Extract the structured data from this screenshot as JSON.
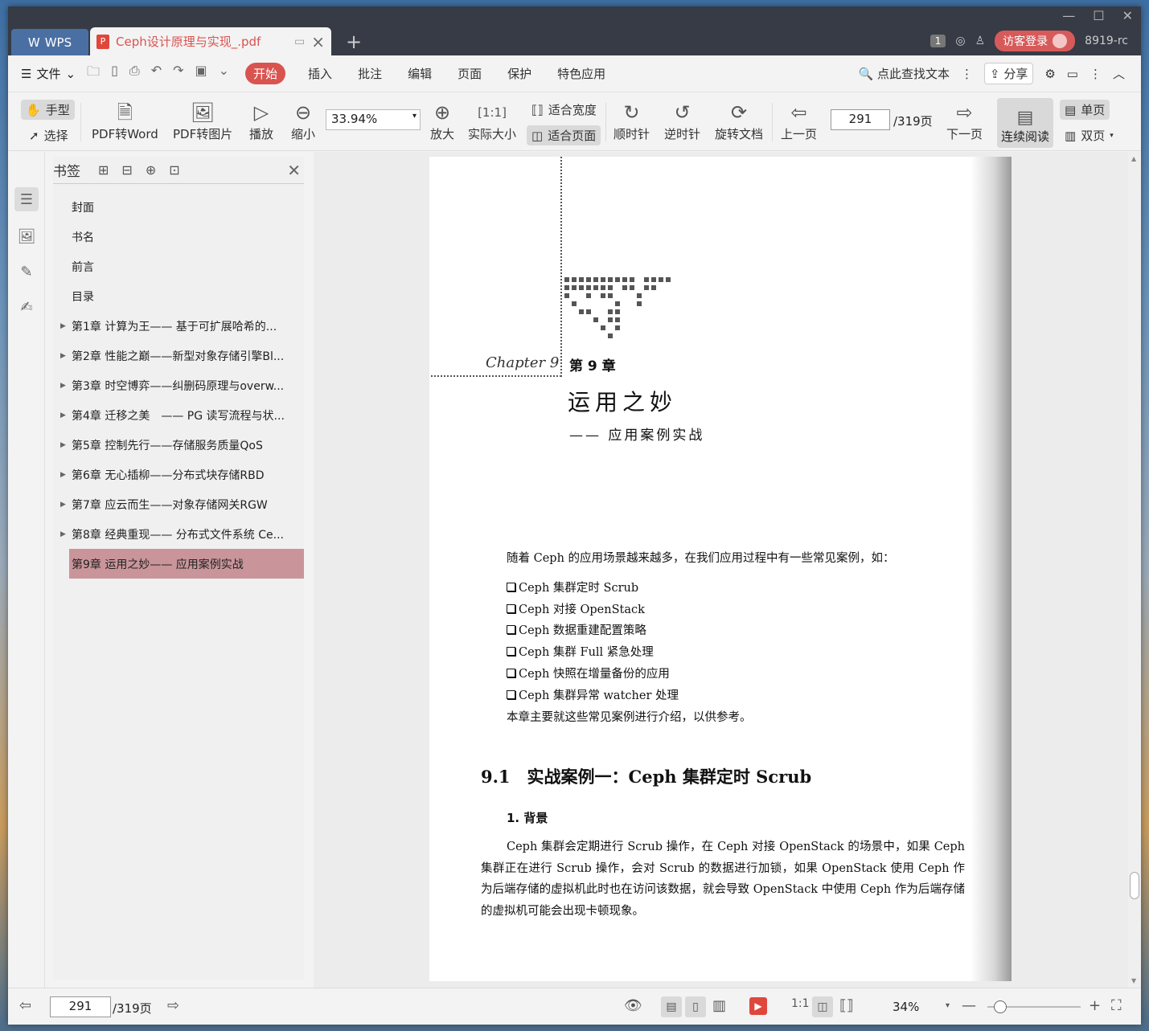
{
  "titlebar": {
    "app_tab": "WPS",
    "doc_tab": "Ceph设计原理与实现_.pdf",
    "badge": "1",
    "login": "访客登录",
    "user_id": "8919-rc"
  },
  "menu": {
    "file": "文件",
    "tabs": [
      "开始",
      "插入",
      "批注",
      "编辑",
      "页面",
      "保护",
      "特色应用"
    ],
    "search": "点此查找文本",
    "share": "分享"
  },
  "toolbar": {
    "hand": "手型",
    "select": "选择",
    "pdf_to_word": "PDF转Word",
    "pdf_to_image": "PDF转图片",
    "play": "播放",
    "zoom_out": "缩小",
    "zoom_value": "33.94%",
    "zoom_in": "放大",
    "actual_size": "实际大小",
    "fit_width": "适合宽度",
    "fit_page": "适合页面",
    "clockwise": "顺时针",
    "counterclockwise": "逆时针",
    "rotate_doc": "旋转文档",
    "prev_page": "上一页",
    "current_page": "291",
    "total_pages": "/319页",
    "next_page": "下一页",
    "continuous": "连续阅读",
    "single": "单页",
    "double": "双页"
  },
  "bookmarks": {
    "title": "书签",
    "items": [
      {
        "label": "封面"
      },
      {
        "label": "书名"
      },
      {
        "label": "前言"
      },
      {
        "label": "目录"
      },
      {
        "label": "第1章 计算为王—— 基于可扩展哈希的..."
      },
      {
        "label": "第2章 性能之巅——新型对象存储引擎Bl..."
      },
      {
        "label": "第3章 时空博弈——纠删码原理与overw..."
      },
      {
        "label": "第4章 迁移之美　—— PG 读写流程与状..."
      },
      {
        "label": "第5章 控制先行——存储服务质量QoS"
      },
      {
        "label": "第6章 无心插柳——分布式块存储RBD"
      },
      {
        "label": "第7章 应云而生——对象存储网关RGW"
      },
      {
        "label": "第8章 经典重现—— 分布式文件系统 Ce..."
      },
      {
        "label": "第9章 运用之妙—— 应用案例实战"
      }
    ]
  },
  "page": {
    "chapter_script": "Chapter 9",
    "chapter_num": "第 9 章",
    "chapter_title": "运用之妙",
    "chapter_subtitle": "—— 应用案例实战",
    "intro": "随着 Ceph 的应用场景越来越多，在我们应用过程中有一些常见案例，如：",
    "checklist": [
      "Ceph 集群定时 Scrub",
      "Ceph 对接 OpenStack",
      "Ceph 数据重建配置策略",
      "Ceph 集群 Full 紧急处理",
      "Ceph 快照在增量备份的应用",
      "Ceph 集群异常 watcher 处理"
    ],
    "summary": "本章主要就这些常见案例进行介绍，以供参考。",
    "section": "9.1　实战案例一：Ceph 集群定时 Scrub",
    "subsection": "1. 背景",
    "paragraph": "Ceph 集群会定期进行 Scrub 操作，在 Ceph 对接 OpenStack 的场景中，如果 Ceph 集群正在进行 Scrub 操作，会对 Scrub 的数据进行加锁，如果 OpenStack 使用 Ceph 作为后端存储的虚拟机此时也在访问该数据，就会导致 OpenStack 中使用 Ceph 作为后端存储的虚拟机可能会出现卡顿现象。"
  },
  "status": {
    "current_page": "291",
    "total_pages": "/319页",
    "zoom": "34%"
  }
}
